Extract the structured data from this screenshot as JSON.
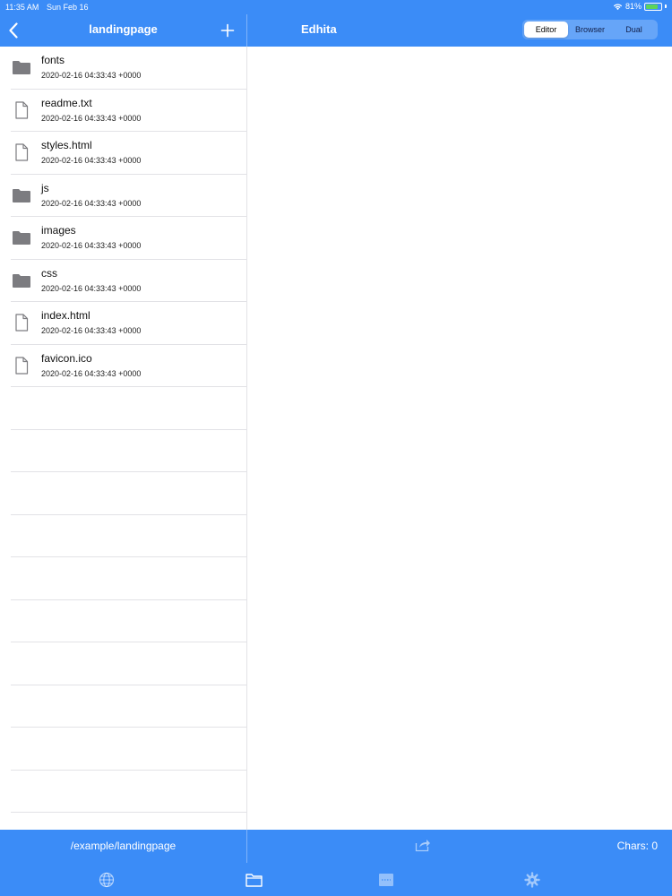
{
  "status_bar": {
    "time": "11:35 AM",
    "date": "Sun Feb 16",
    "battery": "81%",
    "battery_level": 0.81
  },
  "nav": {
    "back_icon": "chevron-left-icon",
    "left_title": "landingpage",
    "add_icon": "plus-icon",
    "right_title": "Edhita",
    "segments": [
      "Editor",
      "Browser",
      "Dual"
    ],
    "active_segment": "Editor"
  },
  "files": [
    {
      "name": "fonts",
      "date": "2020-02-16 04:33:43 +0000",
      "type": "folder"
    },
    {
      "name": "readme.txt",
      "date": "2020-02-16 04:33:43 +0000",
      "type": "file"
    },
    {
      "name": "styles.html",
      "date": "2020-02-16 04:33:43 +0000",
      "type": "file"
    },
    {
      "name": "js",
      "date": "2020-02-16 04:33:43 +0000",
      "type": "folder"
    },
    {
      "name": "images",
      "date": "2020-02-16 04:33:43 +0000",
      "type": "folder"
    },
    {
      "name": "css",
      "date": "2020-02-16 04:33:43 +0000",
      "type": "folder"
    },
    {
      "name": "index.html",
      "date": "2020-02-16 04:33:43 +0000",
      "type": "file"
    },
    {
      "name": "favicon.ico",
      "date": "2020-02-16 04:33:43 +0000",
      "type": "file"
    }
  ],
  "toolbar": {
    "path": "/example/landingpage",
    "share_icon": "share-icon",
    "chars": "Chars: 0"
  },
  "tabs": [
    {
      "icon": "globe-icon"
    },
    {
      "icon": "folder-icon"
    },
    {
      "icon": "keyboard-icon"
    },
    {
      "icon": "gear-icon"
    }
  ],
  "colors": {
    "accent": "#3b8cf7",
    "folder": "#7c7c80",
    "battery": "#5dd35a"
  }
}
